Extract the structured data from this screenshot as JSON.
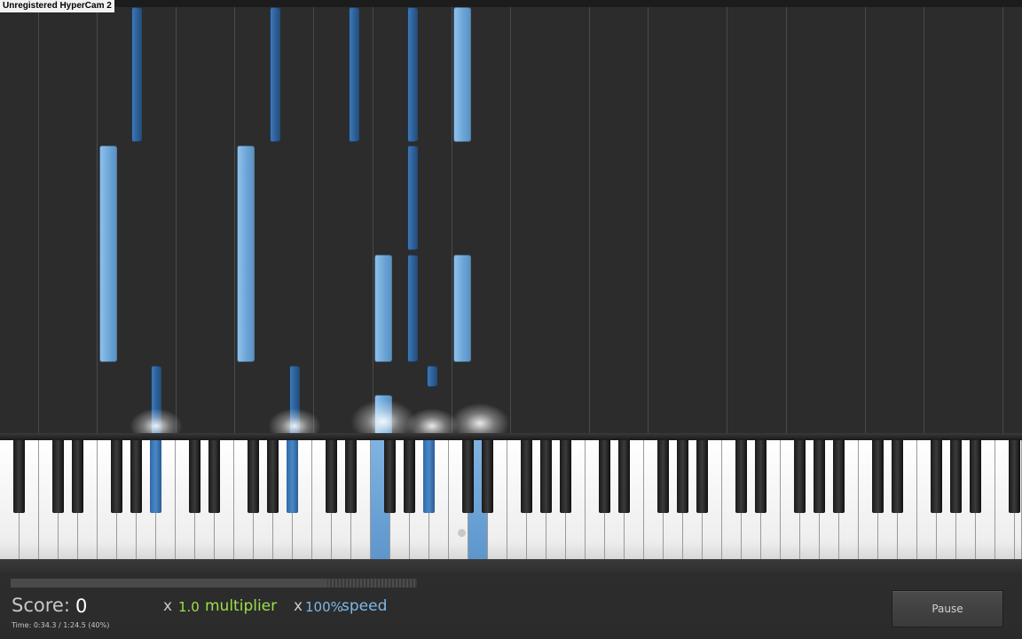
{
  "recorder_watermark": "Unregistered HyperCam 2",
  "score": {
    "label": "Score:",
    "value": "0"
  },
  "time": "Time:    0:34.3  /  1:24.5  (40%)",
  "progress_fraction": 0.78,
  "multiplier": {
    "prefix": "x",
    "value": "1.0",
    "label": "multiplier"
  },
  "speed": {
    "prefix": "x",
    "value": "100%",
    "label": "speed"
  },
  "pause_button": {
    "label": "Pause"
  },
  "colors": {
    "background": "#2b2b2b",
    "note_white": "#6aa4d6",
    "note_black": "#2c5f98",
    "multiplier": "#9be04a",
    "speed": "#7fb8e8"
  },
  "icons": [
    "key-indicator-dot-icon"
  ]
}
